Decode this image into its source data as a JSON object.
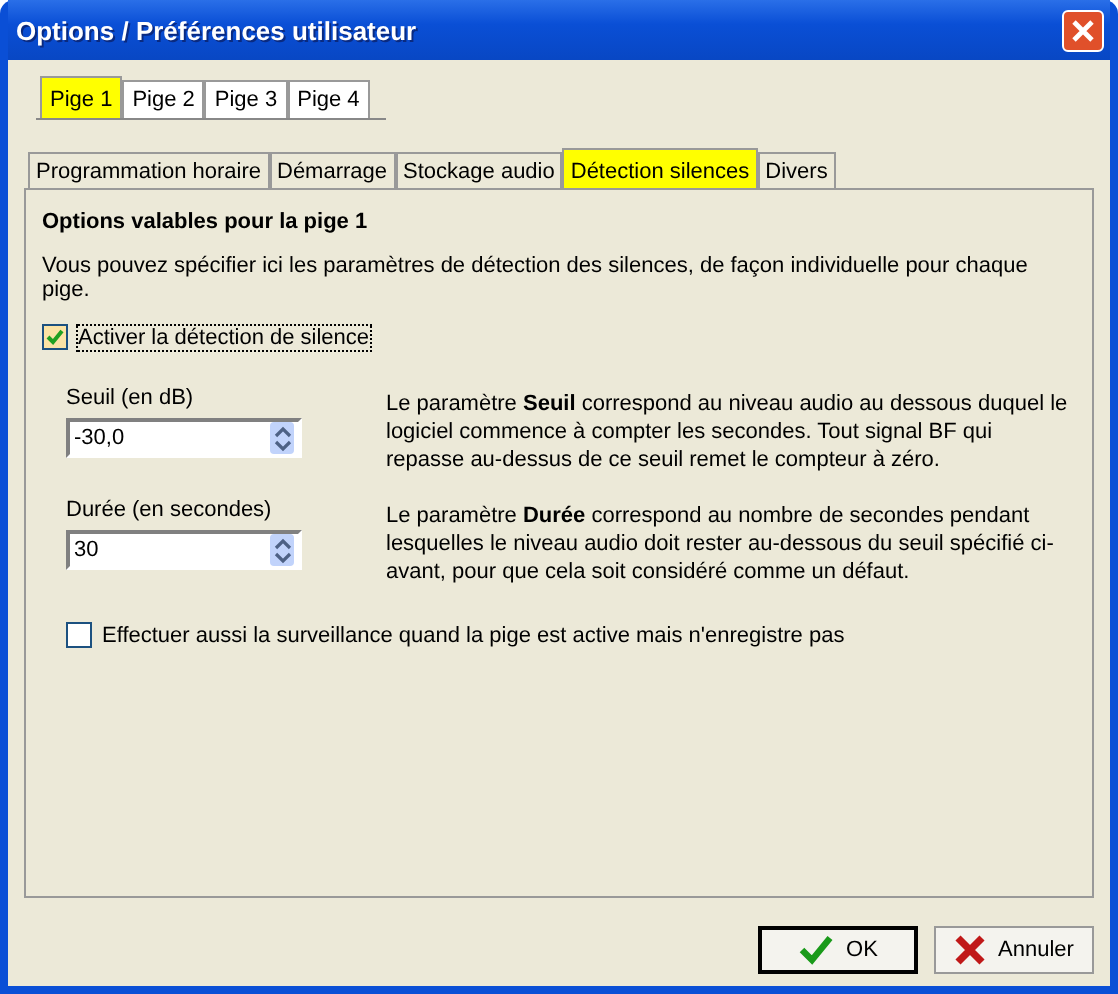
{
  "window": {
    "title": "Options / Préférences utilisateur"
  },
  "page_tabs": [
    {
      "label": "Pige 1",
      "selected": true
    },
    {
      "label": "Pige 2",
      "selected": false
    },
    {
      "label": "Pige 3",
      "selected": false
    },
    {
      "label": "Pige 4",
      "selected": false
    }
  ],
  "tabs": [
    {
      "label": "Programmation horaire",
      "selected": false
    },
    {
      "label": "Démarrage",
      "selected": false
    },
    {
      "label": "Stockage audio",
      "selected": false
    },
    {
      "label": "Détection silences",
      "selected": true
    },
    {
      "label": "Divers",
      "selected": false
    }
  ],
  "heading": "Options valables pour la pige 1",
  "intro": "Vous pouvez spécifier ici les paramètres de détection des silences, de façon individuelle pour chaque pige.",
  "enable": {
    "label": "Activer la détection de silence",
    "checked": true
  },
  "fields": [
    {
      "label": "Seuil (en dB)",
      "value": "-30,0",
      "description": "Le paramètre **Seuil** correspond au niveau audio au dessous duquel le logiciel commence à compter les secondes. Tout signal BF qui repasse au-dessus de ce seuil remet le compteur à zéro."
    },
    {
      "label": "Durée (en secondes)",
      "value": "30",
      "description": "Le paramètre **Durée** correspond au nombre de secondes pendant lesquelles le niveau audio doit rester au-dessous du seuil spécifié ci-avant, pour que cela soit considéré comme un défaut."
    }
  ],
  "monitor": {
    "label": "Effectuer aussi la surveillance quand la pige est active mais n'enregistre pas",
    "checked": false
  },
  "buttons": [
    {
      "label": "OK",
      "kind": "ok"
    },
    {
      "label": "Annuler",
      "kind": "cancel"
    }
  ]
}
